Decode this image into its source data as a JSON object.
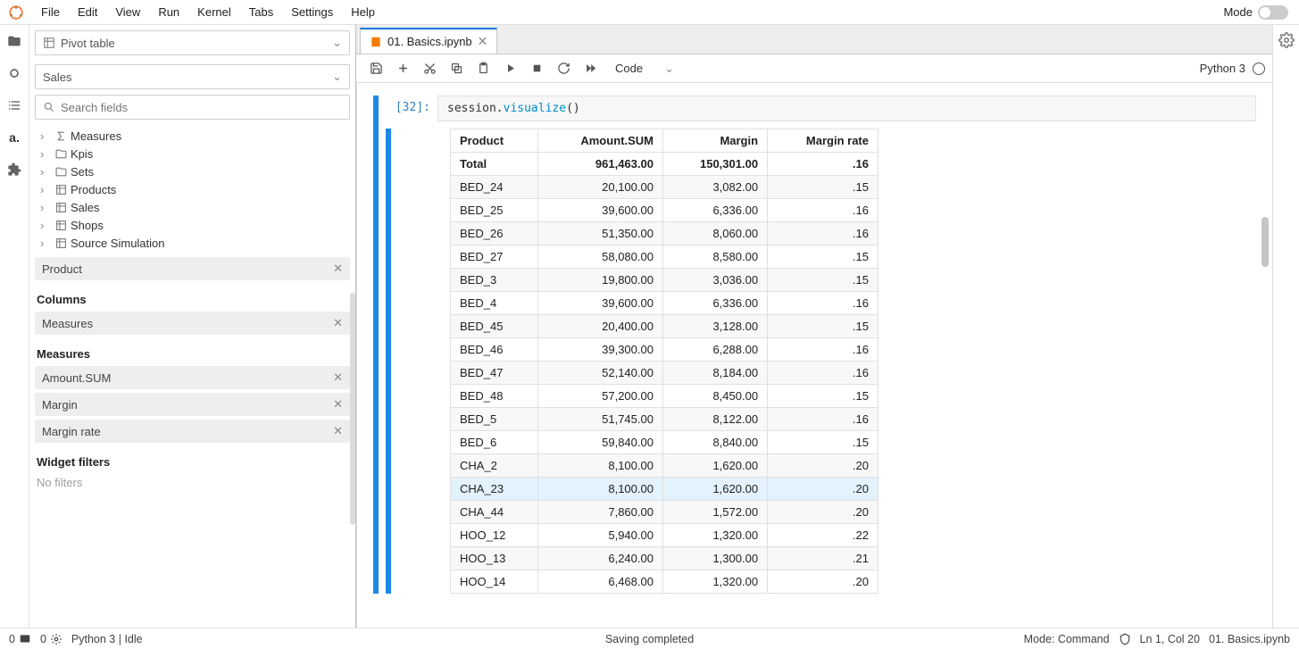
{
  "menu": {
    "items": [
      "File",
      "Edit",
      "View",
      "Run",
      "Kernel",
      "Tabs",
      "Settings",
      "Help"
    ],
    "mode_label": "Mode"
  },
  "activity": {
    "items": [
      "folder-icon",
      "circle-icon",
      "list-icon",
      "atoti-icon",
      "puzzle-icon"
    ]
  },
  "sidepanel": {
    "widget_type_label": "Pivot table",
    "cube_label": "Sales",
    "search_placeholder": "Search fields",
    "tree": [
      {
        "icon": "sigma",
        "label": "Measures"
      },
      {
        "icon": "folder",
        "label": "Kpis"
      },
      {
        "icon": "folder",
        "label": "Sets"
      },
      {
        "icon": "cube",
        "label": "Products"
      },
      {
        "icon": "cube",
        "label": "Sales"
      },
      {
        "icon": "cube",
        "label": "Shops"
      },
      {
        "icon": "cube",
        "label": "Source Simulation"
      }
    ],
    "rows_header_implicit": "Product",
    "columns_header": "Columns",
    "columns_chips": [
      "Measures"
    ],
    "measures_header": "Measures",
    "measures_chips": [
      "Amount.SUM",
      "Margin",
      "Margin rate"
    ],
    "filters_header": "Widget filters",
    "no_filters": "No filters"
  },
  "notebook": {
    "tab_title": "01. Basics.ipynb",
    "celltype": "Code",
    "kernel": "Python 3",
    "prompt": "[32]:",
    "code_prefix": "session.",
    "code_call": "visualize",
    "code_suffix": "()",
    "table": {
      "headers": [
        "Product",
        "Amount.SUM",
        "Margin",
        "Margin rate"
      ],
      "total_row": [
        "Total",
        "961,463.00",
        "150,301.00",
        ".16"
      ],
      "rows": [
        [
          "BED_24",
          "20,100.00",
          "3,082.00",
          ".15"
        ],
        [
          "BED_25",
          "39,600.00",
          "6,336.00",
          ".16"
        ],
        [
          "BED_26",
          "51,350.00",
          "8,060.00",
          ".16"
        ],
        [
          "BED_27",
          "58,080.00",
          "8,580.00",
          ".15"
        ],
        [
          "BED_3",
          "19,800.00",
          "3,036.00",
          ".15"
        ],
        [
          "BED_4",
          "39,600.00",
          "6,336.00",
          ".16"
        ],
        [
          "BED_45",
          "20,400.00",
          "3,128.00",
          ".15"
        ],
        [
          "BED_46",
          "39,300.00",
          "6,288.00",
          ".16"
        ],
        [
          "BED_47",
          "52,140.00",
          "8,184.00",
          ".16"
        ],
        [
          "BED_48",
          "57,200.00",
          "8,450.00",
          ".15"
        ],
        [
          "BED_5",
          "51,745.00",
          "8,122.00",
          ".16"
        ],
        [
          "BED_6",
          "59,840.00",
          "8,840.00",
          ".15"
        ],
        [
          "CHA_2",
          "8,100.00",
          "1,620.00",
          ".20"
        ],
        [
          "CHA_23",
          "8,100.00",
          "1,620.00",
          ".20"
        ],
        [
          "CHA_44",
          "7,860.00",
          "1,572.00",
          ".20"
        ],
        [
          "HOO_12",
          "5,940.00",
          "1,320.00",
          ".22"
        ],
        [
          "HOO_13",
          "6,240.00",
          "1,300.00",
          ".21"
        ],
        [
          "HOO_14",
          "6,468.00",
          "1,320.00",
          ".20"
        ]
      ],
      "highlight_index": 13
    }
  },
  "statusbar": {
    "left_terminals": "0",
    "left_kernels": "0",
    "kernel_status": "Python 3 | Idle",
    "center": "Saving completed",
    "mode": "Mode: Command",
    "cursor": "Ln 1, Col 20",
    "file": "01. Basics.ipynb"
  }
}
